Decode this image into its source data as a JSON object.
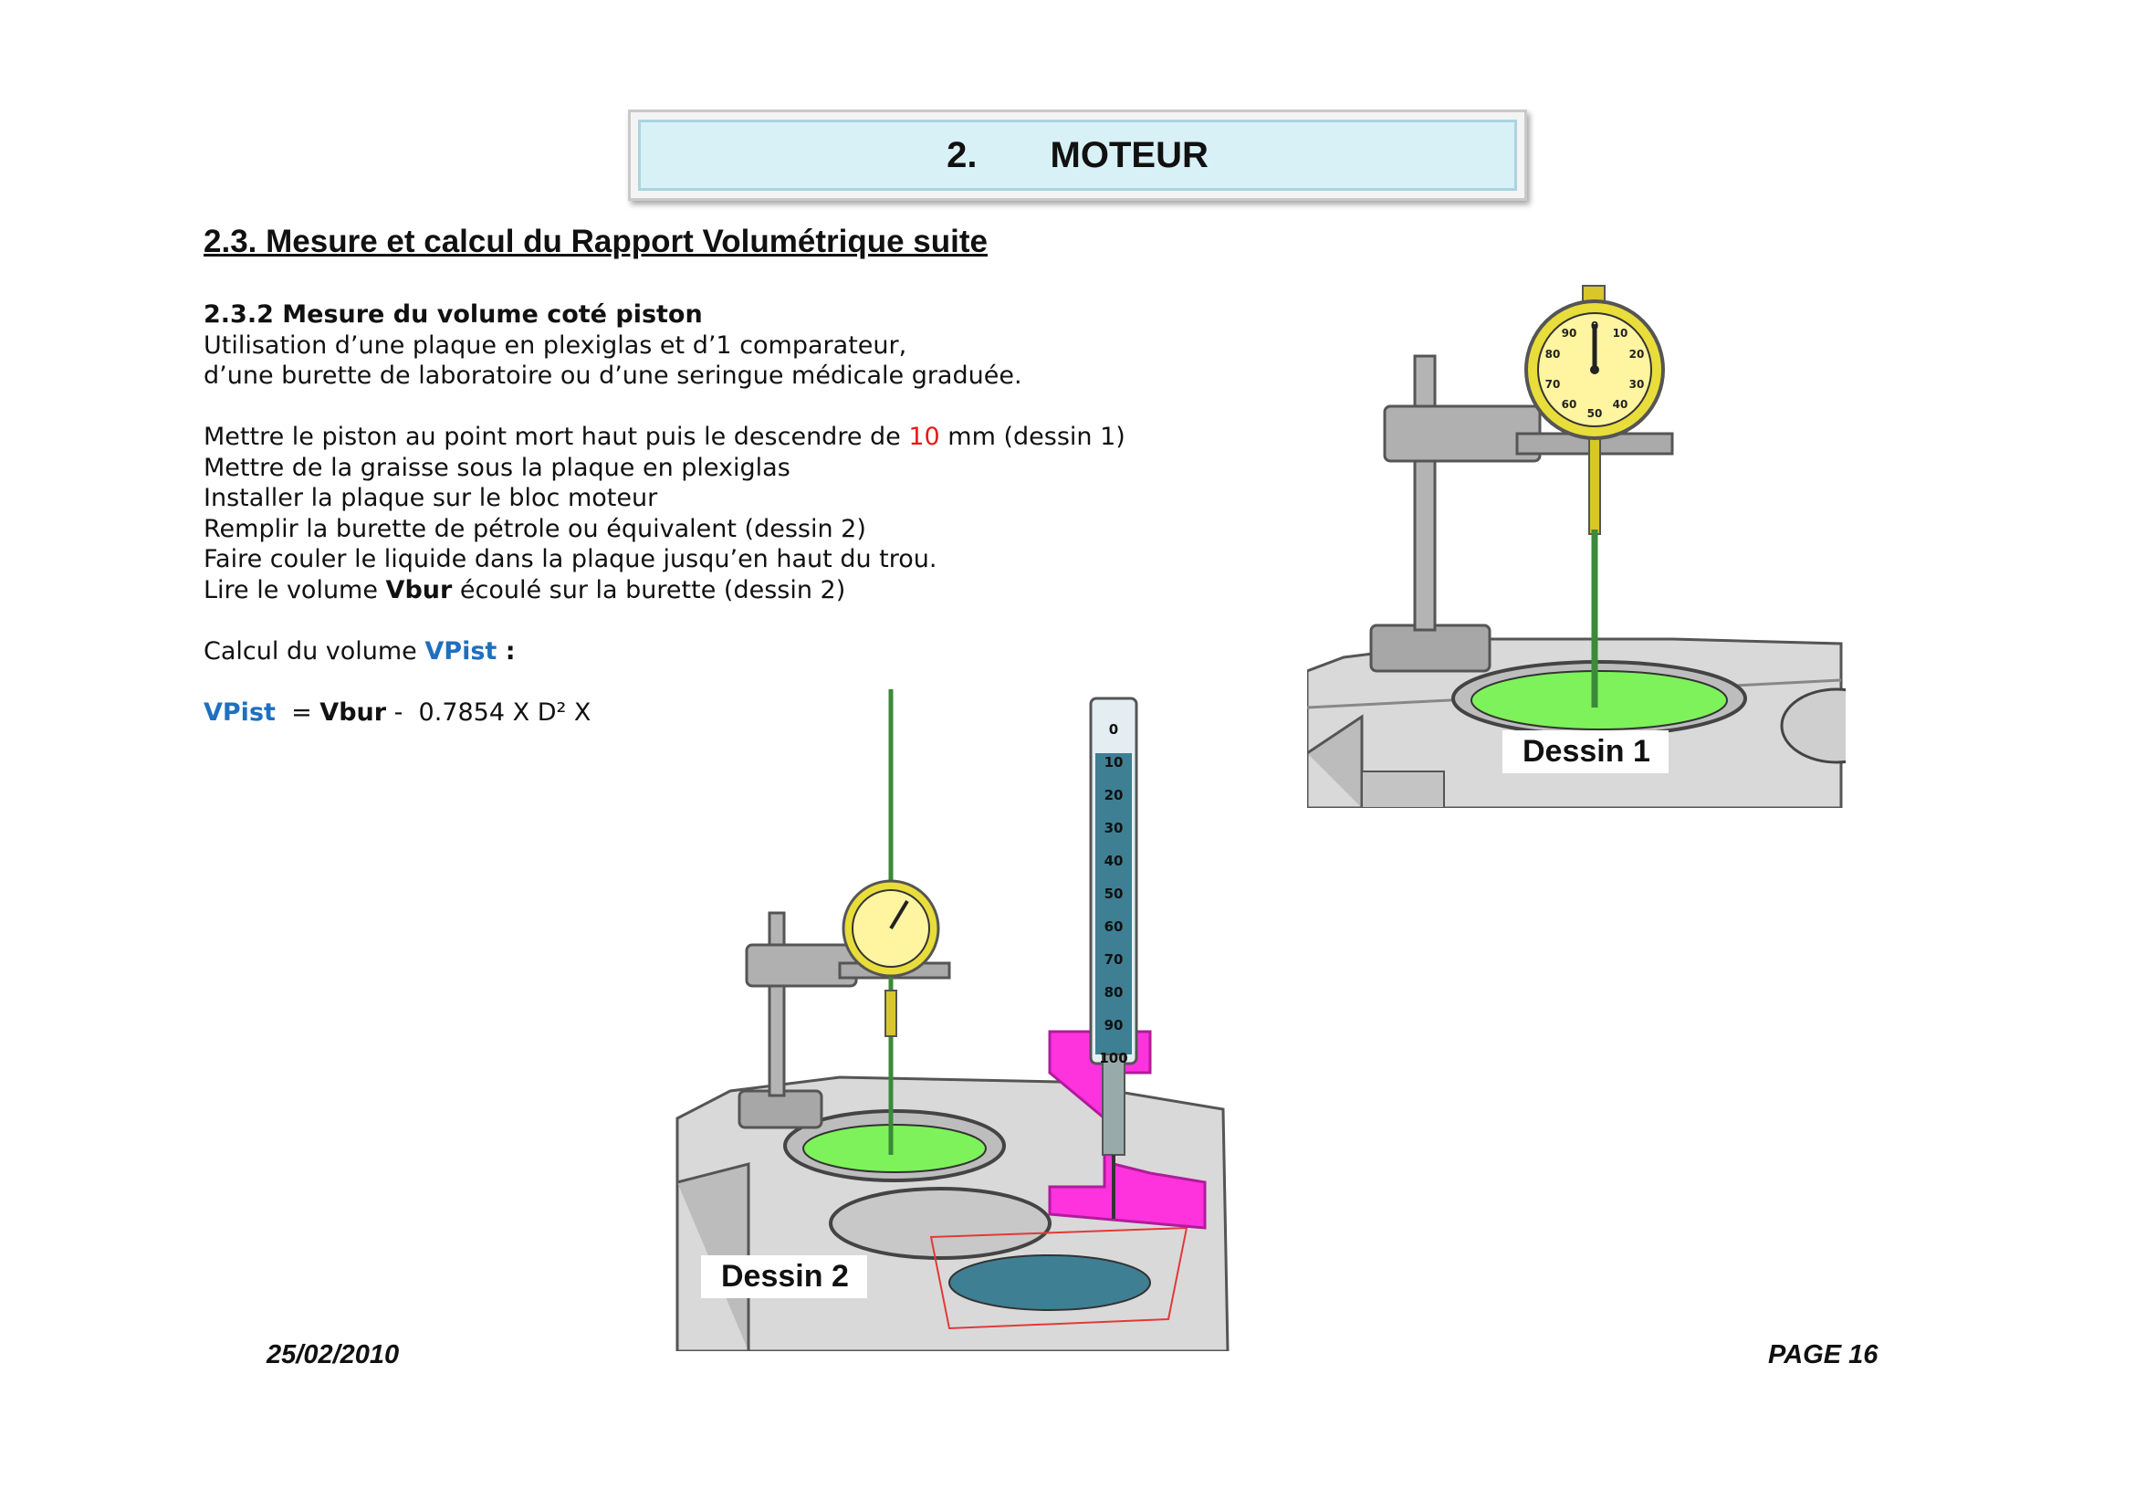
{
  "header": {
    "number": "2.",
    "title": "MOTEUR"
  },
  "section": {
    "title": "2.3. Mesure et calcul du Rapport Volumétrique suite"
  },
  "content": {
    "subtitle": "2.3.2 Mesure du volume coté piston",
    "intro_line1": "Utilisation d’une plaque en plexiglas et d’1 comparateur,",
    "intro_line2": "d’une burette de laboratoire ou d’une seringue médicale graduée.",
    "step1_before": "Mettre le piston au point mort haut puis le descendre de ",
    "step1_value": "10",
    "step1_after": " mm (dessin 1)",
    "step2": "Mettre de la graisse sous la plaque en plexiglas",
    "step3": "Installer la plaque sur le bloc moteur",
    "step4": "Remplir la burette de pétrole ou équivalent (dessin 2)",
    "step5": "Faire couler le liquide dans la plaque jusqu’en haut du trou.",
    "step6_before": "Lire le volume ",
    "step6_bold": "Vbur",
    "step6_after": " écoulé sur la burette (dessin 2)",
    "calc_label": "Calcul du volume ",
    "calc_var": "VPist",
    "calc_colon": " :",
    "formula_var": "VPist",
    "formula_eq": "  = ",
    "formula_bold": "Vbur",
    "formula_rest": " -  0.7854 X D² X"
  },
  "figures": {
    "dessin1_label": "Dessin 1",
    "dessin2_label": "Dessin 2",
    "burette_scale": [
      "0",
      "10",
      "20",
      "30",
      "40",
      "50",
      "60",
      "70",
      "80",
      "90",
      "100"
    ],
    "dial_scale": [
      "0",
      "10",
      "20",
      "30",
      "40",
      "50",
      "60",
      "70",
      "80",
      "90"
    ],
    "colors": {
      "piston_fill": "#7ef25a",
      "liquid_fill": "#3e7f94",
      "support": "#ff33dd",
      "dial": "#e8dd3a",
      "rod": "#3a8a3a"
    }
  },
  "footer": {
    "date": "25/02/2010",
    "page": "PAGE 16"
  }
}
